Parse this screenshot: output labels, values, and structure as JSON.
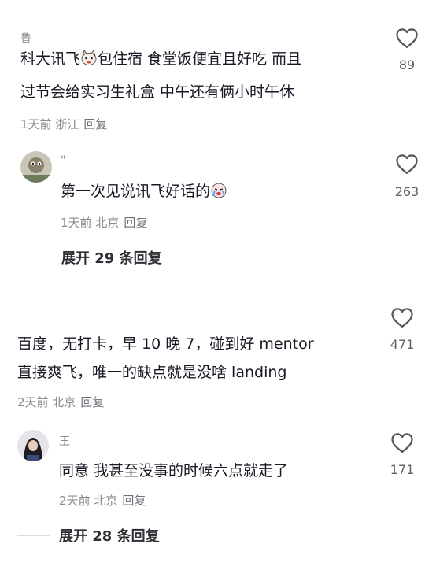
{
  "comments": [
    {
      "username": "鲁",
      "text_line1_a": "科大讯飞",
      "text_line1_b": "包住宿 食堂饭便宜且好吃 而且",
      "text_line2": "过节会给实习生礼盒 中午还有俩小时午休",
      "meta": "1天前 浙江",
      "reply_label": "回复",
      "likes": "89",
      "reply": {
        "username": "\"",
        "text": "第一次见说讯飞好话的",
        "meta": "1天前 北京",
        "reply_label": "回复",
        "likes": "263"
      },
      "expand_label": "展开 29 条回复"
    },
    {
      "username": "",
      "text_line1": "百度，无打卡，早 10 晚 7，碰到好 mentor",
      "text_line2": "直接爽飞，唯一的缺点就是没啥 landing",
      "meta": "2天前 北京",
      "reply_label": "回复",
      "likes": "471",
      "reply": {
        "username": "王",
        "text": "同意 我甚至没事的时候六点就走了",
        "meta": "2天前 北京",
        "reply_label": "回复",
        "likes": "171"
      },
      "expand_label": "展开 28 条回复"
    }
  ],
  "icons": {
    "like": "heart-outline-icon",
    "emoji_cat": "cat-face-emoji-icon",
    "emoji_cry": "crying-face-emoji-icon"
  },
  "colors": {
    "text": "#161823",
    "meta": "#8a8b91"
  }
}
